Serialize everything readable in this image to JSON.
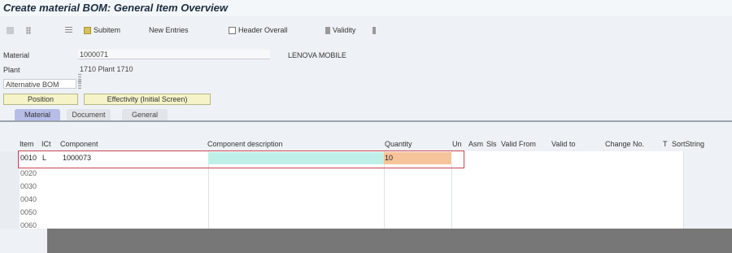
{
  "window": {
    "title": "Create material BOM: General Item Overview"
  },
  "toolbar": {
    "subitem_label": "Subitem",
    "new_entries_label": "New Entries",
    "header_overall_label": "Header Overall",
    "validity_label": "Validity"
  },
  "header": {
    "material_label": "Material",
    "material_value": "1000071",
    "material_desc": "LENOVA MOBILE",
    "plant_label": "Plant",
    "plant_value": "1710 Plant 1710",
    "alt_bom_label": "Alternative BOM",
    "alt_bom_value": "",
    "position_button": "Position",
    "effectivity_button": "Effectivity (Initial Screen)"
  },
  "tabs": [
    {
      "label": "Material",
      "active": true
    },
    {
      "label": "Document",
      "active": false
    },
    {
      "label": "General",
      "active": false
    }
  ],
  "grid": {
    "columns": [
      "Item",
      "ICt",
      "Component",
      "Component description",
      "Quantity",
      "Un",
      "Asm",
      "Sls",
      "Valid From",
      "Valid to",
      "Change No.",
      "T",
      "SortString"
    ],
    "rows": [
      {
        "item": "0010",
        "ict": "L",
        "component": "1000073",
        "description": "",
        "quantity": "10"
      },
      {
        "item": "0020",
        "ict": "",
        "component": "",
        "description": "",
        "quantity": ""
      },
      {
        "item": "0030",
        "ict": "",
        "component": "",
        "description": "",
        "quantity": ""
      },
      {
        "item": "0040",
        "ict": "",
        "component": "",
        "description": "",
        "quantity": ""
      },
      {
        "item": "0050",
        "ict": "",
        "component": "",
        "description": "",
        "quantity": ""
      },
      {
        "item": "0060",
        "ict": "",
        "component": "",
        "description": "",
        "quantity": ""
      }
    ]
  },
  "colors": {
    "highlight_teal": "#bff0e8",
    "highlight_orange": "#f6c49a",
    "selection_border": "#c94652"
  }
}
